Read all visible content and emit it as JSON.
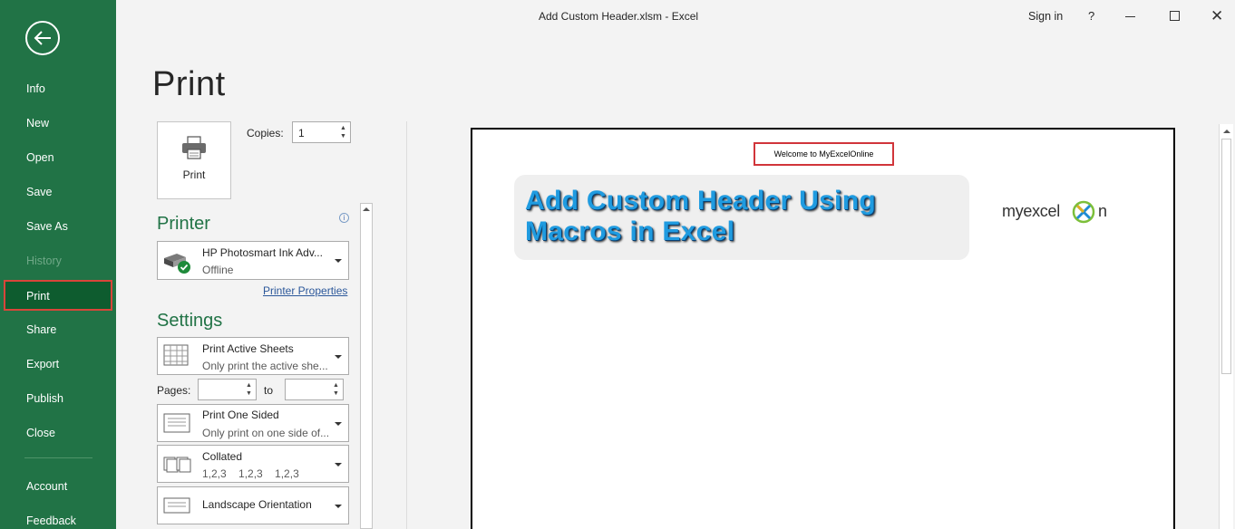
{
  "window": {
    "title": "Add Custom Header.xlsm  -  Excel",
    "sign_in": "Sign in",
    "help": "?",
    "close_glyph": "✕"
  },
  "sidebar": {
    "items": [
      {
        "label": "Info",
        "state": "normal"
      },
      {
        "label": "New",
        "state": "normal"
      },
      {
        "label": "Open",
        "state": "normal"
      },
      {
        "label": "Save",
        "state": "normal"
      },
      {
        "label": "Save As",
        "state": "normal"
      },
      {
        "label": "History",
        "state": "disabled"
      },
      {
        "label": "Print",
        "state": "active"
      },
      {
        "label": "Share",
        "state": "normal"
      },
      {
        "label": "Export",
        "state": "normal"
      },
      {
        "label": "Publish",
        "state": "normal"
      },
      {
        "label": "Close",
        "state": "normal"
      }
    ],
    "bottom_items": [
      {
        "label": "Account"
      },
      {
        "label": "Feedback"
      }
    ]
  },
  "print": {
    "heading": "Print",
    "button_label": "Print",
    "copies_label": "Copies:",
    "copies_value": "1"
  },
  "printer": {
    "section_title": "Printer",
    "info_glyph": "i",
    "name": "HP Photosmart Ink Adv...",
    "status": "Offline",
    "properties_link": "Printer Properties"
  },
  "settings": {
    "section_title": "Settings",
    "active_sheets": {
      "title": "Print Active Sheets",
      "desc": "Only print the active she..."
    },
    "pages_label": "Pages:",
    "pages_from": "",
    "to_label": "to",
    "pages_to": "",
    "sided": {
      "title": "Print One Sided",
      "desc": "Only print on one side of..."
    },
    "collated": {
      "title": "Collated",
      "desc": "1,2,3    1,2,3    1,2,3"
    },
    "orientation": {
      "title": "Landscape Orientation"
    }
  },
  "preview": {
    "header_text": "Welcome to MyExcelOnline",
    "banner_line1": "Add Custom Header Using",
    "banner_line2": "Macros in Excel",
    "logo_text": "myexcel",
    "logo_suffix": "n"
  },
  "colors": {
    "accent": "#217346",
    "active_nav": "#0e5c2f",
    "highlight_border": "#d1353a",
    "link": "#2b579a"
  }
}
